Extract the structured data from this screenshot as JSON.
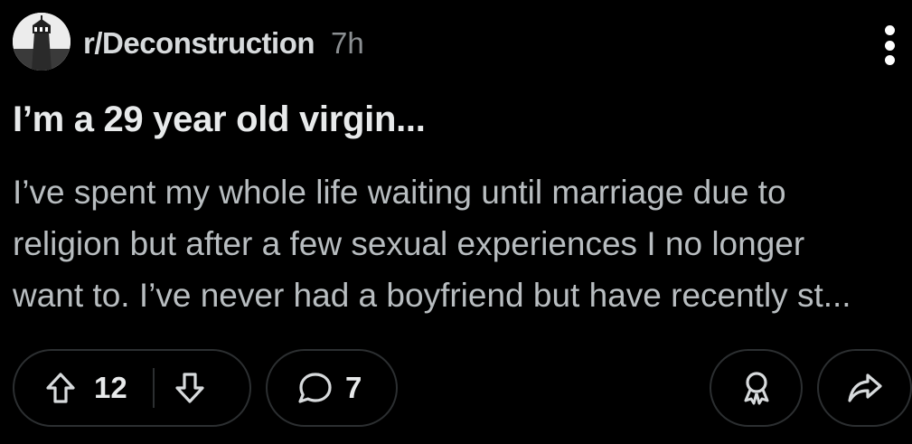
{
  "post": {
    "subreddit": "r/Deconstruction",
    "time_ago": "7h",
    "title": "I’m a 29 year old virgin...",
    "body_lines": [
      "I’ve spent my whole life waiting until marriage due to",
      "religion but after a few sexual experiences I no longer",
      "want to. I’ve never had a boyfriend but have recently st..."
    ]
  },
  "actions": {
    "vote_count": "12",
    "comment_count": "7"
  },
  "icons": {
    "avatar": "lighthouse-avatar",
    "menu": "more-vertical-icon",
    "upvote": "arrow-up-icon",
    "downvote": "arrow-down-icon",
    "comment": "comment-bubble-icon",
    "award": "award-icon",
    "share": "share-icon"
  },
  "colors": {
    "background": "#000000",
    "text": "#d7dadc",
    "muted": "#8b8f92",
    "border": "#2c2f31"
  }
}
